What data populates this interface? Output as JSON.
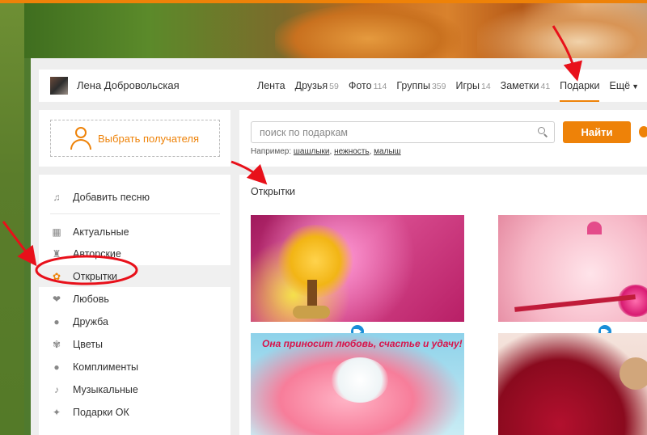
{
  "colors": {
    "accent": "#ee8208",
    "annotation": "#e8101a",
    "video_badge": "#1a8ed8"
  },
  "user": {
    "name": "Лена Добровольская"
  },
  "nav": [
    {
      "label": "Лента",
      "count": ""
    },
    {
      "label": "Друзья",
      "count": "59"
    },
    {
      "label": "Фото",
      "count": "114"
    },
    {
      "label": "Группы",
      "count": "359"
    },
    {
      "label": "Игры",
      "count": "14"
    },
    {
      "label": "Заметки",
      "count": "41"
    },
    {
      "label": "Подарки",
      "count": "",
      "active": true
    },
    {
      "label": "Ещё",
      "count": ""
    }
  ],
  "recipient": {
    "label": "Выбрать получателя",
    "icon": "person-icon"
  },
  "menu": [
    {
      "label": "Добавить песню",
      "icon": "music-note-icon"
    },
    {
      "label": "Актуальные",
      "icon": "grid-icon"
    },
    {
      "label": "Авторские",
      "icon": "author-icon"
    },
    {
      "label": "Открытки",
      "icon": "card-icon",
      "active": true
    },
    {
      "label": "Любовь",
      "icon": "hearts-icon"
    },
    {
      "label": "Дружба",
      "icon": "people-icon"
    },
    {
      "label": "Цветы",
      "icon": "flower-icon"
    },
    {
      "label": "Комплименты",
      "icon": "speech-bubble-icon"
    },
    {
      "label": "Музыкальные",
      "icon": "music-note-icon"
    },
    {
      "label": "Подарки ОК",
      "icon": "ok-icon"
    }
  ],
  "search": {
    "placeholder": "поиск по подаркам",
    "button": "Найти",
    "example_prefix": "Например:",
    "examples": [
      "шашлыки",
      "нежность",
      "малыш"
    ]
  },
  "section": {
    "title": "Открытки"
  },
  "cards": [
    {
      "name": "money-tree-card",
      "video": true
    },
    {
      "name": "hearts-pearls-card",
      "video": true
    },
    {
      "name": "dove-heart-card",
      "caption": "Она приносит любовь, счастье и удачу!",
      "video": false
    },
    {
      "name": "roses-bear-card",
      "video": false
    }
  ]
}
